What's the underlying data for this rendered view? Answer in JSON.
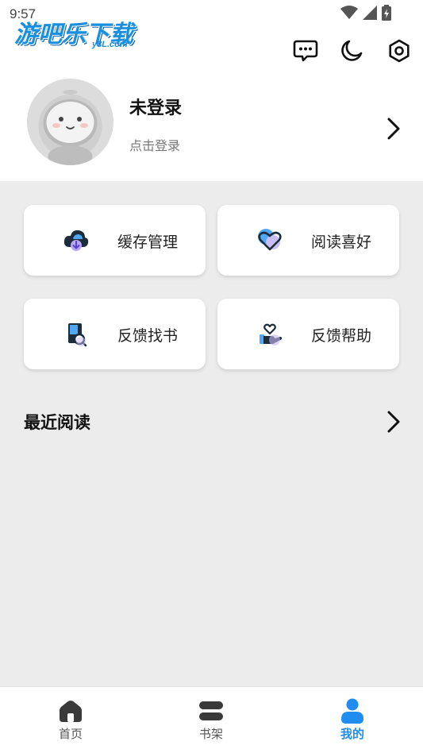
{
  "status_bar": {
    "time": "9:57"
  },
  "watermark": {
    "title": "游吧乐下载",
    "sub": "y8L.com"
  },
  "profile": {
    "name": "未登录",
    "subtitle": "点击登录"
  },
  "menu": [
    {
      "label": "缓存管理",
      "icon": "cloud-download-icon"
    },
    {
      "label": "阅读喜好",
      "icon": "heart-icon"
    },
    {
      "label": "反馈找书",
      "icon": "book-search-icon"
    },
    {
      "label": "反馈帮助",
      "icon": "hand-heart-icon"
    }
  ],
  "recent": {
    "title": "最近阅读"
  },
  "tabs": [
    {
      "label": "首页",
      "icon": "home-icon"
    },
    {
      "label": "书架",
      "icon": "bookshelf-icon"
    },
    {
      "label": "我的",
      "icon": "user-icon",
      "active": true
    }
  ],
  "colors": {
    "accent": "#1f8cf0",
    "background": "#ececec"
  }
}
